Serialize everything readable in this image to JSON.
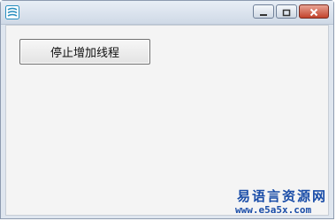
{
  "window": {
    "icon": "app-stripes-icon",
    "controls": [
      "minimize-icon",
      "restore-icon",
      "close-icon"
    ]
  },
  "main": {
    "stop_button_label": "停止增加线程"
  },
  "watermark": {
    "line1": "易语言资源网",
    "line2": "www.e5a5x.com"
  },
  "colors": {
    "title_bar": "#dfe6ef",
    "close_button": "#c2432c",
    "watermark": "#1a4da8",
    "client_bg": "#f4f4f4"
  }
}
